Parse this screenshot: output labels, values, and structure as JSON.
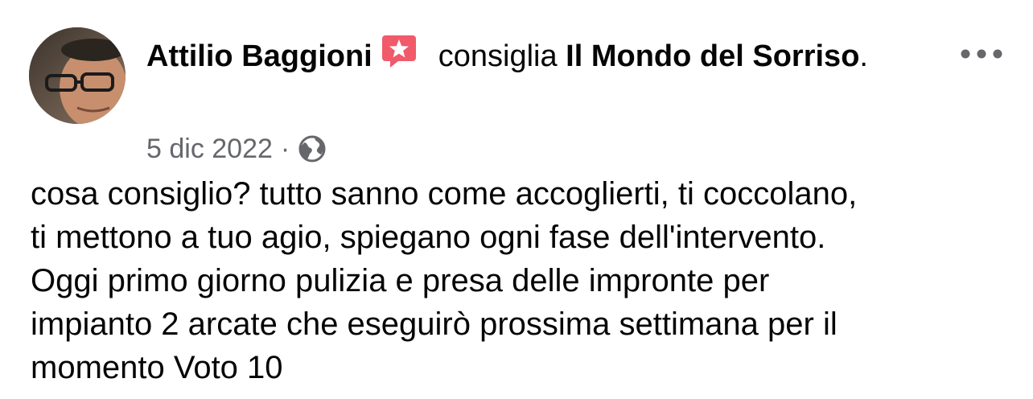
{
  "post": {
    "author": "Attilio Baggioni",
    "action": "consiglia",
    "page_name": "Il Mondo del Sorriso",
    "page_suffix": ".",
    "date": "5 dic 2022",
    "separator": "·",
    "privacy_icon": "globe-icon",
    "badge_icon": "recommendation-star-icon",
    "badge_color": "#f15a6a",
    "more_icon": "more-options-icon",
    "lines": [
      "cosa consiglio? tutto sanno come accoglierti, ti coccolano,",
      "ti mettono a tuo agio, spiegano ogni fase dell'intervento.",
      "Oggi primo giorno pulizia e presa delle impronte per",
      "impianto 2 arcate che eseguirò prossima settimana per il",
      "momento Voto 10"
    ]
  }
}
